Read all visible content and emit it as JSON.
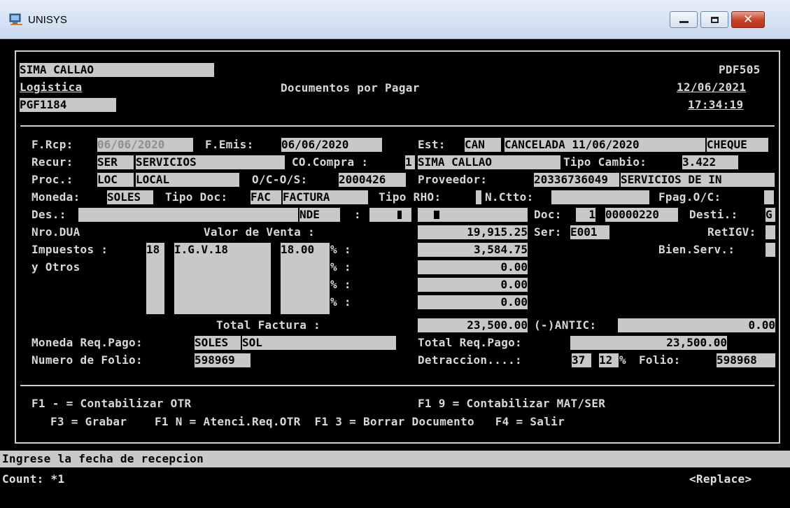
{
  "window": {
    "title": "UNISYS"
  },
  "header": {
    "company": "SIMA CALLAO",
    "module": "Logistica",
    "program": "PGF1184",
    "screen_title": "Documentos por Pagar",
    "screen_code": "PDF505",
    "date": "12/06/2021",
    "time": "17:34:19"
  },
  "labels": {
    "f_rcp": "F.Rcp:",
    "f_emis": "F.Emis:",
    "est": "Est:",
    "recur": "Recur:",
    "co_compra": "CO.Compra :",
    "tipo_cambio": "Tipo Cambio:",
    "proc": "Proc.:",
    "oc_os": "O/C-O/S:",
    "proveedor": "Proveedor:",
    "moneda": "Moneda:",
    "tipo_doc": "Tipo Doc:",
    "tipo_rho": "Tipo RHO:",
    "n_ctto": "N.Ctto:",
    "fpag_oc": "Fpag.O/C:",
    "des": "Des.:",
    "colon": ":",
    "doc": "Doc:",
    "desti": "Desti.:",
    "nro_dua": "Nro.DUA",
    "valor_venta": "Valor de Venta :",
    "ser": "Ser:",
    "retigv": "RetIGV:",
    "impuestos": "Impuestos :",
    "pct_colon": "% :",
    "bien_serv": "Bien.Serv.:",
    "y_otros": "y Otros",
    "total_factura": "Total Factura :",
    "antic": "(-)ANTIC:",
    "moneda_req_pago": "Moneda Req.Pago:",
    "total_req_pago": "Total Req.Pago:",
    "numero_folio": "Numero de Folio:",
    "detraccion": "Detraccion....:",
    "folio": "Folio:"
  },
  "fields": {
    "f_rcp": "06/06/2020",
    "f_emis": "06/06/2020",
    "est_code": "CAN",
    "est_desc": "CANCELADA 11/06/2020",
    "est_pay": "CHEQUE",
    "recur_code": "SER",
    "recur_desc": "SERVICIOS",
    "co_compra": "1",
    "co_name": "SIMA CALLAO",
    "tipo_cambio": "3.422",
    "proc_code": "LOC",
    "proc_desc": "LOCAL",
    "oc_os": "2000426",
    "proveedor_ruc": "20336736049",
    "proveedor_name": "SERVICIOS DE IN",
    "moneda": "SOLES",
    "tipo_doc_code": "FAC",
    "tipo_doc_desc": "FACTURA",
    "nde": "NDE",
    "doc_serie": "1",
    "doc_number": "00000220",
    "desti": "G",
    "valor_venta": "19,915.25",
    "ser": "E001",
    "imp_code": "18",
    "imp_desc": "I.G.V.18",
    "imp_pct": "18.00",
    "imp_amount": "3,584.75",
    "other_amounts": [
      "0.00",
      "0.00",
      "0.00"
    ],
    "total_factura": "23,500.00",
    "antic": "0.00",
    "moneda_req_pago": "SOLES",
    "moneda_req_desc": "SOL",
    "total_req_pago": "23,500.00",
    "numero_folio": "598969",
    "detraccion_code": "37",
    "detraccion_pct": "12",
    "folio": "598968"
  },
  "function_keys": {
    "line1_left": "F1 - = Contabilizar OTR",
    "line1_right": "F1 9 = Contabilizar MAT/SER",
    "line2": "F3 = Grabar    F1 N = Atenci.Req.OTR  F1 3 = Borrar Documento   F4 = Salir"
  },
  "status": {
    "message": "Ingrese la fecha de recepcion",
    "count": "Count: *1",
    "mode": "<Replace>"
  }
}
